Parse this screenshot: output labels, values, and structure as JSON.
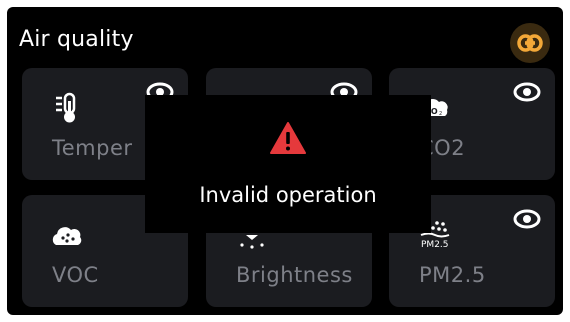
{
  "header": {
    "title": "Air quality",
    "link_icon": "link-icon"
  },
  "colors": {
    "background": "#000000",
    "card": "#1b1c20",
    "label": "#7e8088",
    "accent": "#f3a838",
    "warning": "#e5393c"
  },
  "cards": [
    {
      "label": "Temper",
      "icon": "thermometer-icon",
      "visible_icon": "eye-icon"
    },
    {
      "label": "",
      "icon": "humidity-icon",
      "visible_icon": "eye-icon"
    },
    {
      "label": "CO2",
      "icon": "co2-cloud-icon",
      "visible_icon": "eye-icon"
    },
    {
      "label": "VOC",
      "icon": "voc-cloud-icon",
      "visible_icon": ""
    },
    {
      "label": "Brightness",
      "icon": "brightness-icon",
      "visible_icon": ""
    },
    {
      "label": "PM2.5",
      "icon": "pm25-icon",
      "icon_text": "PM2.5",
      "visible_icon": "eye-icon"
    }
  ],
  "toast": {
    "icon": "warning-icon",
    "message": "Invalid operation"
  }
}
